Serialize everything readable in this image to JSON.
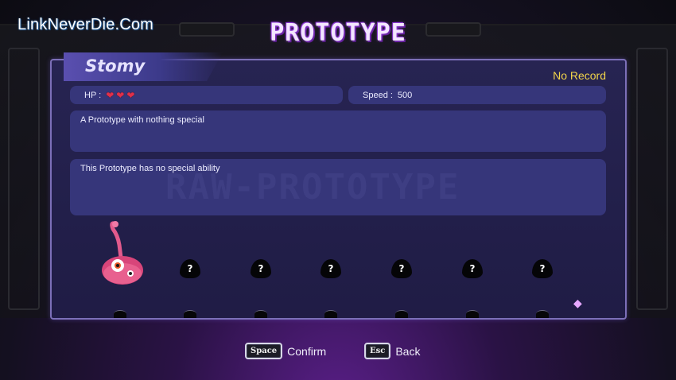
{
  "watermark": "LinkNeverDie.Com",
  "title": "PROTOTYPE",
  "character": {
    "name": "Stomy",
    "record": "No Record",
    "hp_label": "HP :",
    "hp_hearts": 3,
    "speed_label": "Speed :",
    "speed_value": "500",
    "description": "A Prototype with nothing special",
    "ability": "This Prototype has no special ability",
    "faded_banner": "RAW-PROTOTYPE"
  },
  "roster": {
    "unlocked": [
      "stomy-creature-icon"
    ],
    "locked_slots": [
      "?",
      "?",
      "?",
      "?",
      "?",
      "?"
    ]
  },
  "colors": {
    "record": "#f2d54a",
    "heart": "#e0304a",
    "panel_border": "#7c6fb8",
    "box_bg": "#36367a"
  },
  "hints": [
    {
      "key": "Space",
      "label": "Confirm"
    },
    {
      "key": "Esc",
      "label": "Back"
    }
  ]
}
